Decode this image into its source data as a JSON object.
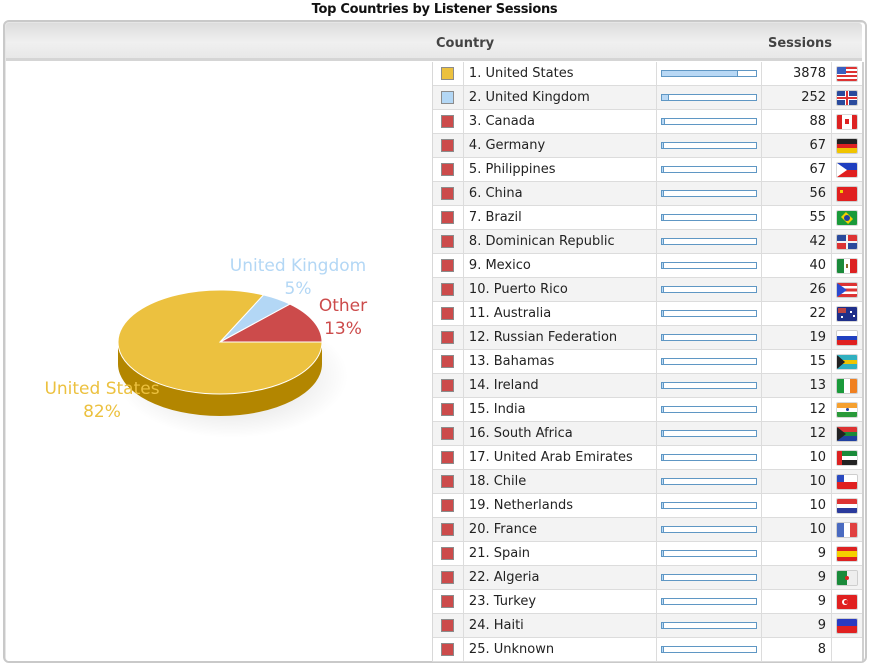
{
  "title": "Top Countries by Listener Sessions",
  "table": {
    "header_country": "Country",
    "header_sessions": "Sessions",
    "max_sessions": 3878,
    "rows": [
      {
        "rank": "1. United States",
        "sessions": 3878,
        "swatch": "#ecc13f",
        "flag": "flag-us",
        "bar": 0.8
      },
      {
        "rank": "2. United Kingdom",
        "sessions": 252,
        "swatch": "#b3d7f5",
        "flag": "flag-gb",
        "bar": 0.065
      },
      {
        "rank": "3. Canada",
        "sessions": 88,
        "swatch": "#cc4b4b",
        "flag": "flag-ca",
        "bar": 0.023
      },
      {
        "rank": "4. Germany",
        "sessions": 67,
        "swatch": "#cc4b4b",
        "flag": "flag-de",
        "bar": 0.017
      },
      {
        "rank": "5. Philippines",
        "sessions": 67,
        "swatch": "#cc4b4b",
        "flag": "flag-ph",
        "bar": 0.017
      },
      {
        "rank": "6. China",
        "sessions": 56,
        "swatch": "#cc4b4b",
        "flag": "flag-cn",
        "bar": 0.014
      },
      {
        "rank": "7. Brazil",
        "sessions": 55,
        "swatch": "#cc4b4b",
        "flag": "flag-br",
        "bar": 0.014
      },
      {
        "rank": "8. Dominican Republic",
        "sessions": 42,
        "swatch": "#cc4b4b",
        "flag": "flag-do",
        "bar": 0.011
      },
      {
        "rank": "9. Mexico",
        "sessions": 40,
        "swatch": "#cc4b4b",
        "flag": "flag-mx",
        "bar": 0.01
      },
      {
        "rank": "10. Puerto Rico",
        "sessions": 26,
        "swatch": "#cc4b4b",
        "flag": "flag-pr",
        "bar": 0.007
      },
      {
        "rank": "11. Australia",
        "sessions": 22,
        "swatch": "#cc4b4b",
        "flag": "flag-au",
        "bar": 0.006
      },
      {
        "rank": "12. Russian Federation",
        "sessions": 19,
        "swatch": "#cc4b4b",
        "flag": "flag-ru",
        "bar": 0.005
      },
      {
        "rank": "13. Bahamas",
        "sessions": 15,
        "swatch": "#cc4b4b",
        "flag": "flag-bs",
        "bar": 0.004
      },
      {
        "rank": "14. Ireland",
        "sessions": 13,
        "swatch": "#cc4b4b",
        "flag": "flag-ie",
        "bar": 0.003
      },
      {
        "rank": "15. India",
        "sessions": 12,
        "swatch": "#cc4b4b",
        "flag": "flag-in",
        "bar": 0.003
      },
      {
        "rank": "16. South Africa",
        "sessions": 12,
        "swatch": "#cc4b4b",
        "flag": "flag-za",
        "bar": 0.003
      },
      {
        "rank": "17. United Arab Emirates",
        "sessions": 10,
        "swatch": "#cc4b4b",
        "flag": "flag-ae",
        "bar": 0.003
      },
      {
        "rank": "18. Chile",
        "sessions": 10,
        "swatch": "#cc4b4b",
        "flag": "flag-cl",
        "bar": 0.003
      },
      {
        "rank": "19. Netherlands",
        "sessions": 10,
        "swatch": "#cc4b4b",
        "flag": "flag-nl",
        "bar": 0.003
      },
      {
        "rank": "20. France",
        "sessions": 10,
        "swatch": "#cc4b4b",
        "flag": "flag-fr",
        "bar": 0.003
      },
      {
        "rank": "21. Spain",
        "sessions": 9,
        "swatch": "#cc4b4b",
        "flag": "flag-es",
        "bar": 0.002
      },
      {
        "rank": "22. Algeria",
        "sessions": 9,
        "swatch": "#cc4b4b",
        "flag": "flag-dz",
        "bar": 0.002
      },
      {
        "rank": "23. Turkey",
        "sessions": 9,
        "swatch": "#cc4b4b",
        "flag": "flag-tr",
        "bar": 0.002
      },
      {
        "rank": "24. Haiti",
        "sessions": 9,
        "swatch": "#cc4b4b",
        "flag": "flag-ht",
        "bar": 0.002
      },
      {
        "rank": "25. Unknown",
        "sessions": 8,
        "swatch": "#cc4b4b",
        "flag": "none",
        "bar": 0.002
      }
    ]
  },
  "chart_data": {
    "type": "pie",
    "title": "Top Countries by Listener Sessions",
    "style": "3d",
    "slices": [
      {
        "label": "Other",
        "value": 13,
        "display": "13%",
        "color": "#cc4b4b",
        "side_color": "#9e3434"
      },
      {
        "label": "United Kingdom",
        "value": 5,
        "display": "5%",
        "color": "#b3d7f5",
        "side_color": "#8ab3d6"
      },
      {
        "label": "United States",
        "value": 82,
        "display": "82%",
        "color": "#ecc13f",
        "side_color": "#b38600"
      }
    ],
    "label_colors": {
      "United States": "#ecc13f",
      "United Kingdom": "#b3d7f5",
      "Other": "#cc4b4b"
    }
  }
}
